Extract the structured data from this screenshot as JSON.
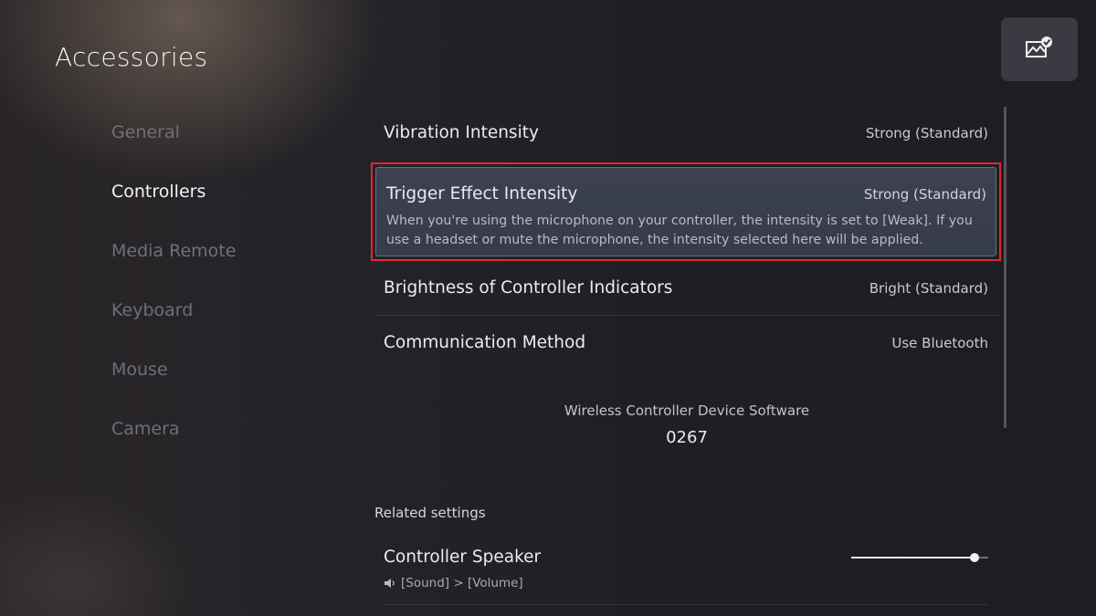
{
  "header": {
    "title": "Accessories"
  },
  "corner_button": {
    "icon": "screenshot-edit-icon"
  },
  "sidebar": {
    "items": [
      {
        "label": "General"
      },
      {
        "label": "Controllers"
      },
      {
        "label": "Media Remote"
      },
      {
        "label": "Keyboard"
      },
      {
        "label": "Mouse"
      },
      {
        "label": "Camera"
      }
    ],
    "selected": "Controllers"
  },
  "settings": {
    "vibration": {
      "label": "Vibration Intensity",
      "value": "Strong (Standard)"
    },
    "trigger": {
      "label": "Trigger Effect Intensity",
      "value": "Strong (Standard)",
      "description": "When you're using the microphone on your controller, the intensity is set to [Weak]. If you use a headset or mute the microphone, the intensity selected here will be applied."
    },
    "brightness": {
      "label": "Brightness of Controller Indicators",
      "value": "Bright (Standard)"
    },
    "communication": {
      "label": "Communication Method",
      "value": "Use Bluetooth"
    }
  },
  "software": {
    "label": "Wireless Controller Device Software",
    "version": "0267"
  },
  "related": {
    "title": "Related settings",
    "speaker": {
      "label": "Controller Speaker",
      "path": "[Sound] > [Volume]",
      "volume_fraction": 0.9,
      "icon": "speaker-icon"
    }
  },
  "colors": {
    "focus_outline": "#e5252f",
    "accent_text": "#ececf0"
  }
}
